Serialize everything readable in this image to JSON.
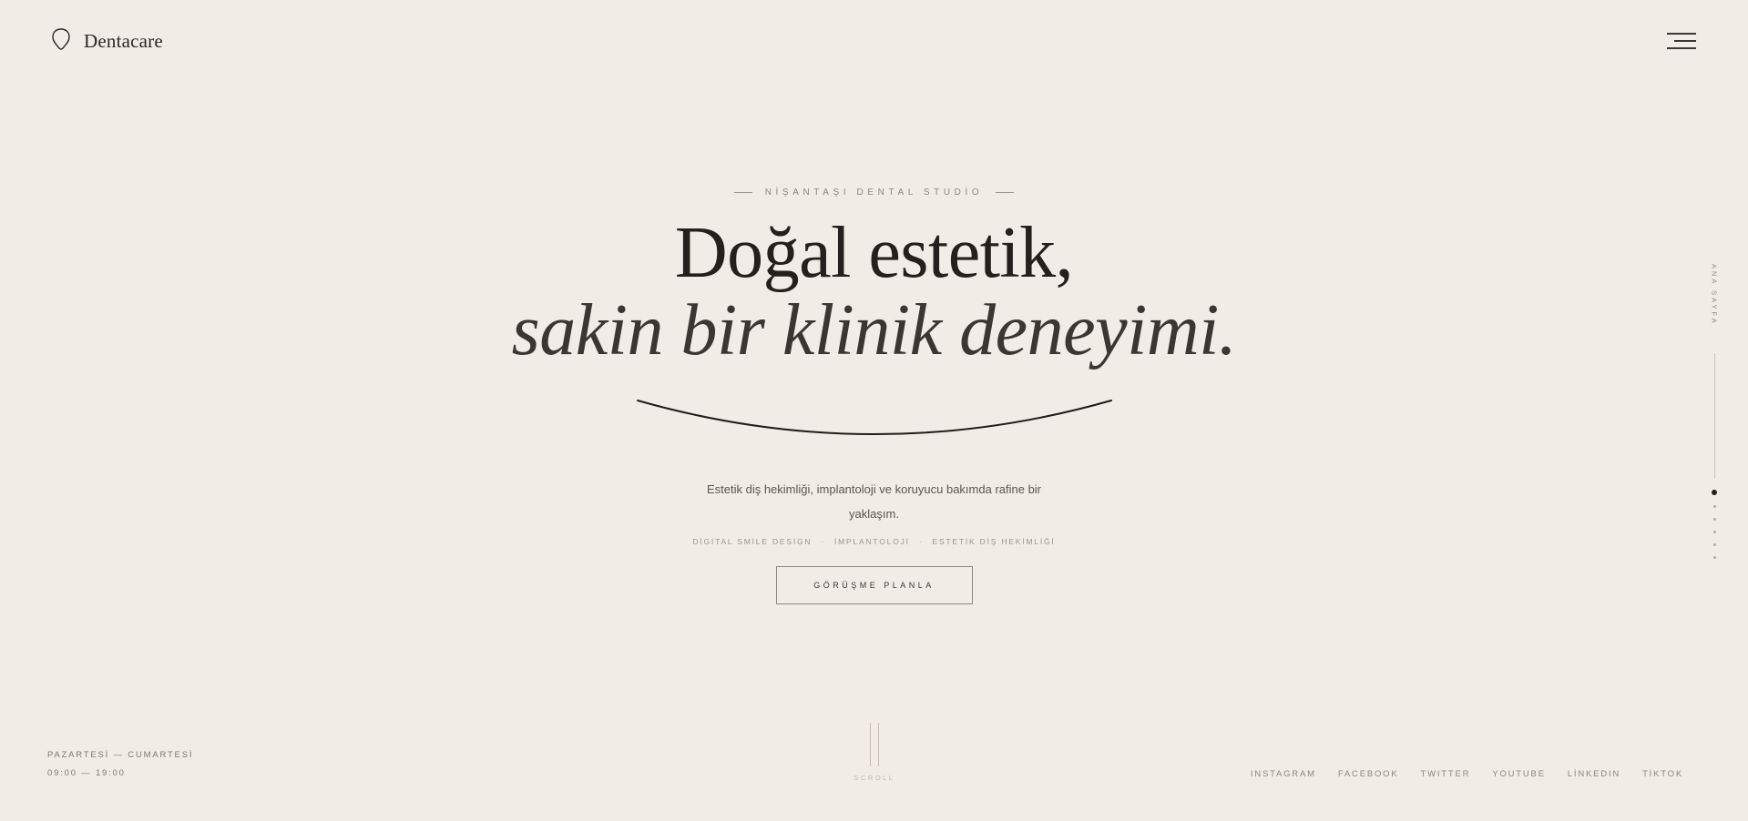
{
  "brand": {
    "name": "Dentacare"
  },
  "hero": {
    "eyebrow": "NİŞANTAŞI DENTAL STUDİO",
    "title": "Doğal estetik,",
    "subtitle": "sakin bir klinik deneyimi.",
    "description": "Estetik diş hekimliği, implantoloji ve koruyucu bakımda rafine bir yaklaşım.",
    "tags": [
      "DİGİTAL SMİLE DESİGN",
      "İMPLANTOLOJİ",
      "ESTETİK DİŞ HEKİMLİĞİ"
    ],
    "cta_label": "GÖRÜŞME PLANLA"
  },
  "side_nav": {
    "label": "ANA SAYFA",
    "dot_count": 6,
    "active_index": 0
  },
  "hours": {
    "days": "PAZARTESİ — CUMARTESİ",
    "time": "09:00 — 19:00"
  },
  "scroll": {
    "label": "SCROLL"
  },
  "social": [
    "INSTAGRAM",
    "FACEBOOK",
    "TWITTER",
    "YOUTUBE",
    "LİNKEDIN",
    "TİKTOK"
  ],
  "icons": {
    "logo": "tooth-icon",
    "menu": "hamburger-menu-icon"
  },
  "colors": {
    "background": "#f1ece6",
    "text": "#23201d",
    "muted": "#8c867e"
  }
}
